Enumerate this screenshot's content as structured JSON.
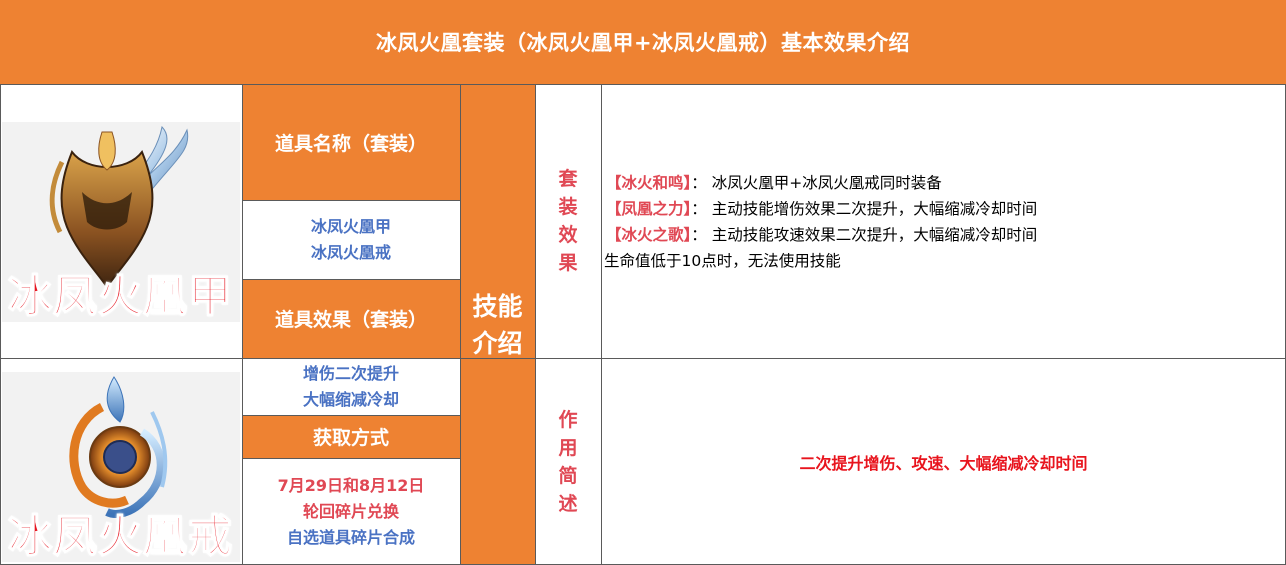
{
  "header": {
    "title": "冰凤火凰套装（冰凤火凰甲+冰凤火凰戒）基本效果介绍"
  },
  "item_name_label": "道具名称（套装）",
  "item_names": [
    "冰凤火凰甲",
    "冰凤火凰戒"
  ],
  "item_effect_label": "道具效果（套装）",
  "item_effects": [
    "增伤二次提升",
    "大幅缩减冷却"
  ],
  "obtain_label": "获取方式",
  "obtain": {
    "date": "7月29日和8月12日",
    "methods": [
      "轮回碎片兑换",
      "自选道具碎片合成"
    ]
  },
  "skill_label": [
    "技能",
    "介绍"
  ],
  "set_effect_label": [
    "套",
    "装",
    "效",
    "果"
  ],
  "set_effects": [
    {
      "tag": "【冰火和鸣】",
      "sep": "：",
      "text": "冰凤火凰甲+冰凤火凰戒同时装备"
    },
    {
      "tag": "【凤凰之力】",
      "sep": "：",
      "text": "主动技能增伤效果二次提升，大幅缩减冷却时间"
    },
    {
      "tag": "【冰火之歌】",
      "sep": "：",
      "text": "主动技能攻速效果二次提升，大幅缩减冷却时间"
    }
  ],
  "set_effect_note": "生命值低于10点时，无法使用技能",
  "summary_label": [
    "作",
    "用",
    "简",
    "述"
  ],
  "summary_text": "二次提升增伤、攻速、大幅缩减冷却时间",
  "art": {
    "armor_name": "冰凤火凰甲",
    "ring_name": "冰凤火凰戒"
  },
  "colors": {
    "orange": "#ee8232",
    "blue": "#4a72c3",
    "red": "#e04854",
    "bright_red": "#e8141d"
  },
  "icons": {
    "armor": "phoenix-helmet-icon",
    "ring": "phoenix-ring-icon"
  }
}
